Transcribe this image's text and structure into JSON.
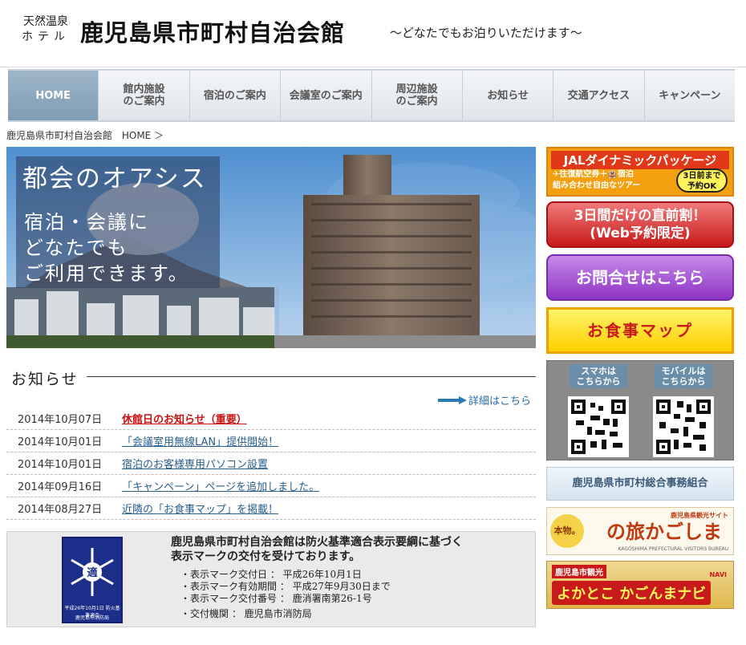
{
  "header": {
    "onsen_line1": "天然温泉",
    "onsen_line2": "ホテル",
    "brand": "鹿児島県市町村自治会館",
    "tagline": "～どなたでもお泊りいただけます～"
  },
  "nav": [
    {
      "label": "HOME",
      "active": true
    },
    {
      "label": "館内施設\nのご案内",
      "active": false
    },
    {
      "label": "宿泊のご案内",
      "active": false
    },
    {
      "label": "会議室のご案内",
      "active": false
    },
    {
      "label": "周辺施設\nのご案内",
      "active": false
    },
    {
      "label": "お知らせ",
      "active": false
    },
    {
      "label": "交通アクセス",
      "active": false
    },
    {
      "label": "キャンペーン",
      "active": false
    }
  ],
  "breadcrumb": {
    "site": "鹿児島県市町村自治会館",
    "current": "HOME ＞"
  },
  "hero": {
    "title": "都会のオアシス",
    "line1": "宿泊・会議に",
    "line2": "どなたでも",
    "line3": "ご利用できます。"
  },
  "news": {
    "heading": "お知らせ",
    "more_label": "詳細はこちら",
    "items": [
      {
        "date": "2014年10月07日",
        "title": "休館日のお知らせ（重要）",
        "important": true
      },
      {
        "date": "2014年10月01日",
        "title": "「会議室用無線LAN」提供開始！",
        "important": false
      },
      {
        "date": "2014年10月01日",
        "title": "宿泊のお客様専用パソコン設置",
        "important": false
      },
      {
        "date": "2014年09月16日",
        "title": "「キャンペーン」ページを追加しました。",
        "important": false
      },
      {
        "date": "2014年08月27日",
        "title": "近隣の「お食事マップ」を掲載！",
        "important": false
      }
    ]
  },
  "fire": {
    "line1": "鹿児島県市町村自治会館は防火基準適合表示要綱に基づく",
    "line2": "表示マークの交付を受けております。",
    "items": [
      "・表示マーク交付日 ： 平成26年10月1日",
      "・表示マーク有効期間 ： 平成27年9月30日まで",
      "・表示マーク交付番号 ： 鹿消署南第26-1号",
      "・交付機関 ： 鹿児島市消防局"
    ],
    "mark_center": "適",
    "mark_text1": "平成26年10月1日 防火基準適合",
    "mark_text2": "鹿児島市消防局"
  },
  "sidebar": {
    "jal_title": "JALダイナミックパッケージ",
    "jal_sub1": "✈往復航空券＋🏨宿泊",
    "jal_sub2": "組み合わせ自由なツアー",
    "jal_badge1": "3日前まで",
    "jal_badge2": "予約OK",
    "deal_line1": "3日間だけの直前割！",
    "deal_line2": "(Web予約限定)",
    "contact": "お問合せはこちら",
    "food_map": "お食事マップ",
    "qr_smart1": "スマホは",
    "qr_smart2": "こちらから",
    "qr_mobile1": "モバイルは",
    "qr_mobile2": "こちらから",
    "union": "鹿児島県市町村総合事務組合",
    "tabi_honmono": "本物。",
    "tabi_main": "の旅かごしま",
    "tabi_small": "鹿児島県観光サイト",
    "tabi_bureau": "KAGOSHIMA PREFECTURAL VISITORS BUREAU",
    "kg_top": "鹿児島市観光",
    "kg_main": "よかとこ かごんまナビ",
    "kg_navi": "NAVI"
  },
  "colors": {
    "nav_active": "#8aa7be",
    "link": "#2a5f8f",
    "important": "#cc1111"
  }
}
